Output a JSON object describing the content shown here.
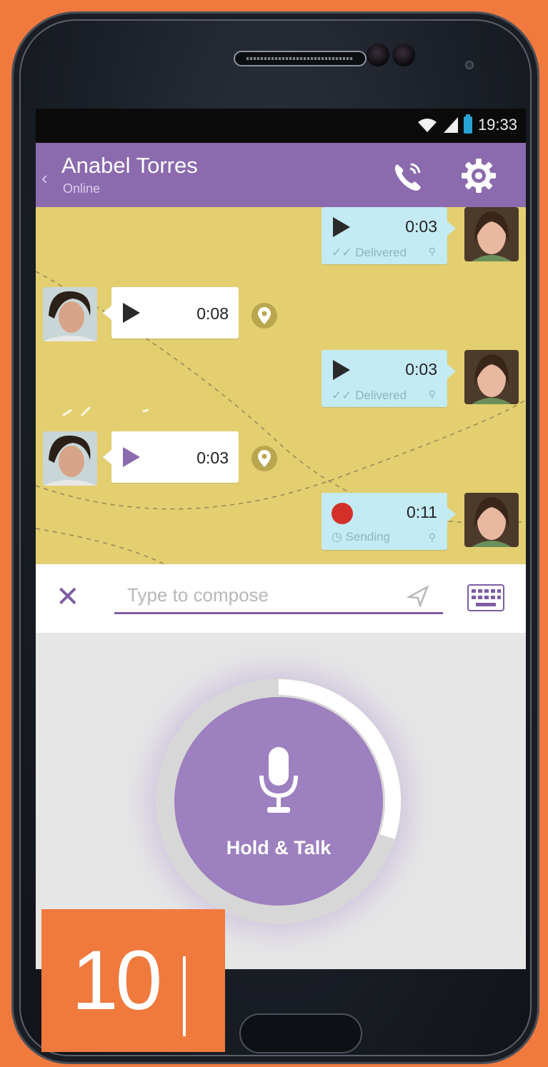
{
  "status_bar": {
    "time": "19:33"
  },
  "header": {
    "contact_name": "Anabel Torres",
    "contact_status": "Online",
    "back_glyph": "‹"
  },
  "messages": [
    {
      "direction": "outgoing",
      "icon": "play-icon",
      "duration": "0:03",
      "status": "Delivered"
    },
    {
      "direction": "incoming",
      "icon": "play-icon",
      "duration": "0:08"
    },
    {
      "direction": "outgoing",
      "icon": "play-icon",
      "duration": "0:03",
      "status": "Delivered"
    },
    {
      "direction": "incoming",
      "icon": "play-icon",
      "duration": "0:03"
    },
    {
      "direction": "outgoing",
      "icon": "record-dot",
      "duration": "0:11",
      "status": "Sending"
    }
  ],
  "compose": {
    "placeholder": "Type to compose",
    "close_glyph": "✕"
  },
  "talk": {
    "label": "Hold & Talk",
    "recording_progress": 0.3
  },
  "overlay": {
    "number": "10"
  },
  "colors": {
    "accent": "#8b6aae",
    "chat_background": "#e3cf70",
    "outgoing_bubble": "#c4eaf4",
    "recording": "#d3302a",
    "frame": "#f07a3e"
  }
}
